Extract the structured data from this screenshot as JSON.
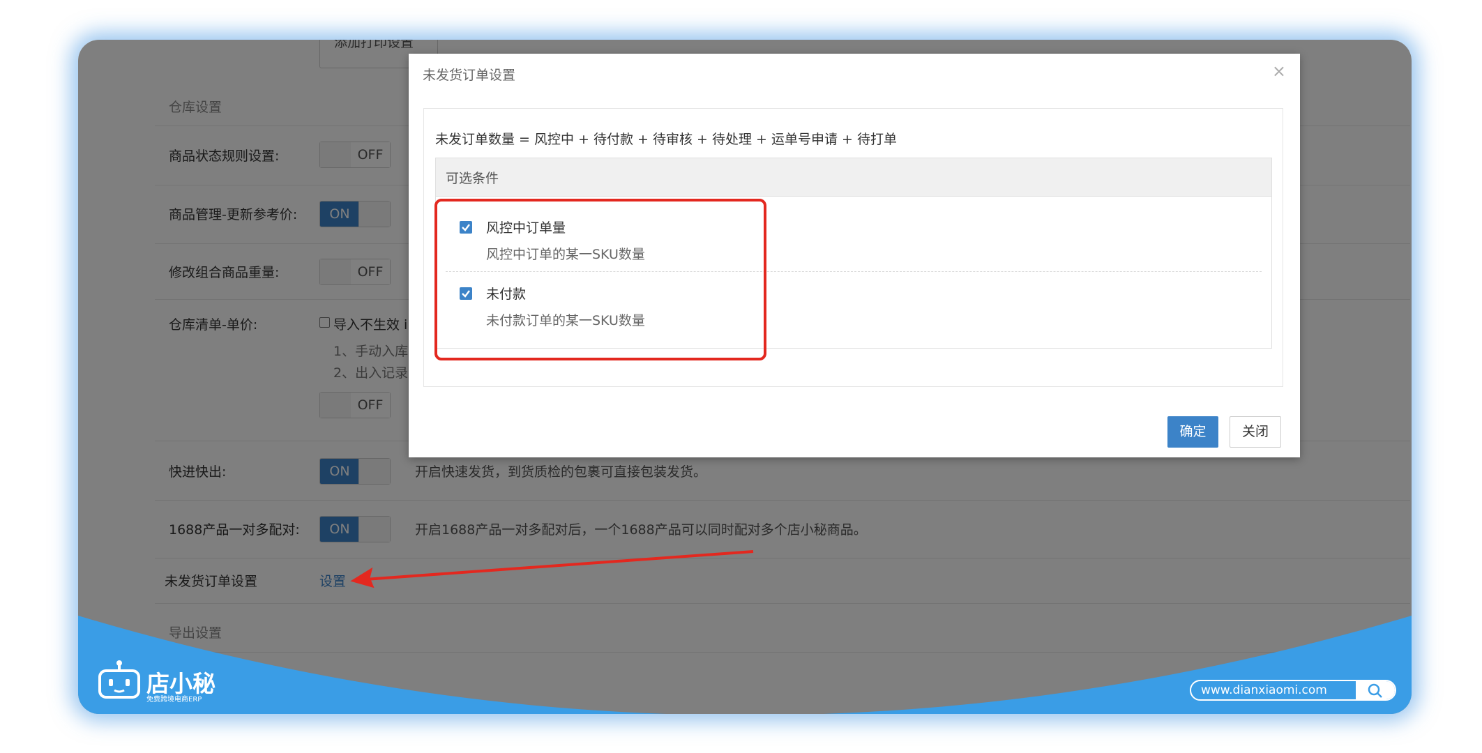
{
  "page": {
    "top_button_fragment": "添加打印设置",
    "warehouse_section_title": "仓库设置",
    "rows": [
      {
        "label": "商品状态规则设置:",
        "toggle": "OFF",
        "desc": ""
      },
      {
        "label": "商品管理-更新参考价:",
        "toggle": "ON",
        "desc": ""
      },
      {
        "label": "修改组合商品重量:",
        "toggle": "OFF",
        "desc": ""
      },
      {
        "label": "快进快出:",
        "toggle": "ON",
        "desc": "开启快速发货，到货质检的包裹可直接包装发货。"
      },
      {
        "label": "1688产品一对多配对:",
        "toggle": "ON",
        "desc": "开启1688产品一对多配对后，一个1688产品可以同时配对多个店小秘商品。"
      }
    ],
    "inventory_label": "仓库清单-单价:",
    "inventory_checkbox_label": "导入不生效 i",
    "inventory_note_1": "1、手动入库",
    "inventory_note_2": "2、出入记录",
    "inventory_toggle": "OFF",
    "unshipped_label": "未发货订单设置",
    "unshipped_link": "设置",
    "export_section_title": "导出设置"
  },
  "brand": {
    "name": "店小秘",
    "tagline": "免费跨境电商ERP",
    "url": "www.dianxiaomi.com",
    "search_icon": "search-icon",
    "wave_color": "#3a9de6"
  },
  "modal": {
    "title": "未发货订单设置",
    "close_icon": "×",
    "formula": "未发订单数量 = 风控中 + 待付款 + 待审核 + 待处理 + 运单号申请 + 待打单",
    "conditions_header": "可选条件",
    "options": [
      {
        "label": "风控中订单量",
        "desc": "风控中订单的某一SKU数量",
        "checked": true
      },
      {
        "label": "未付款",
        "desc": "未付款订单的某一SKU数量",
        "checked": true
      }
    ],
    "confirm_label": "确定",
    "close_label": "关闭"
  },
  "colors": {
    "accent": "#3c83c8",
    "annotation_red": "#e3281f"
  }
}
